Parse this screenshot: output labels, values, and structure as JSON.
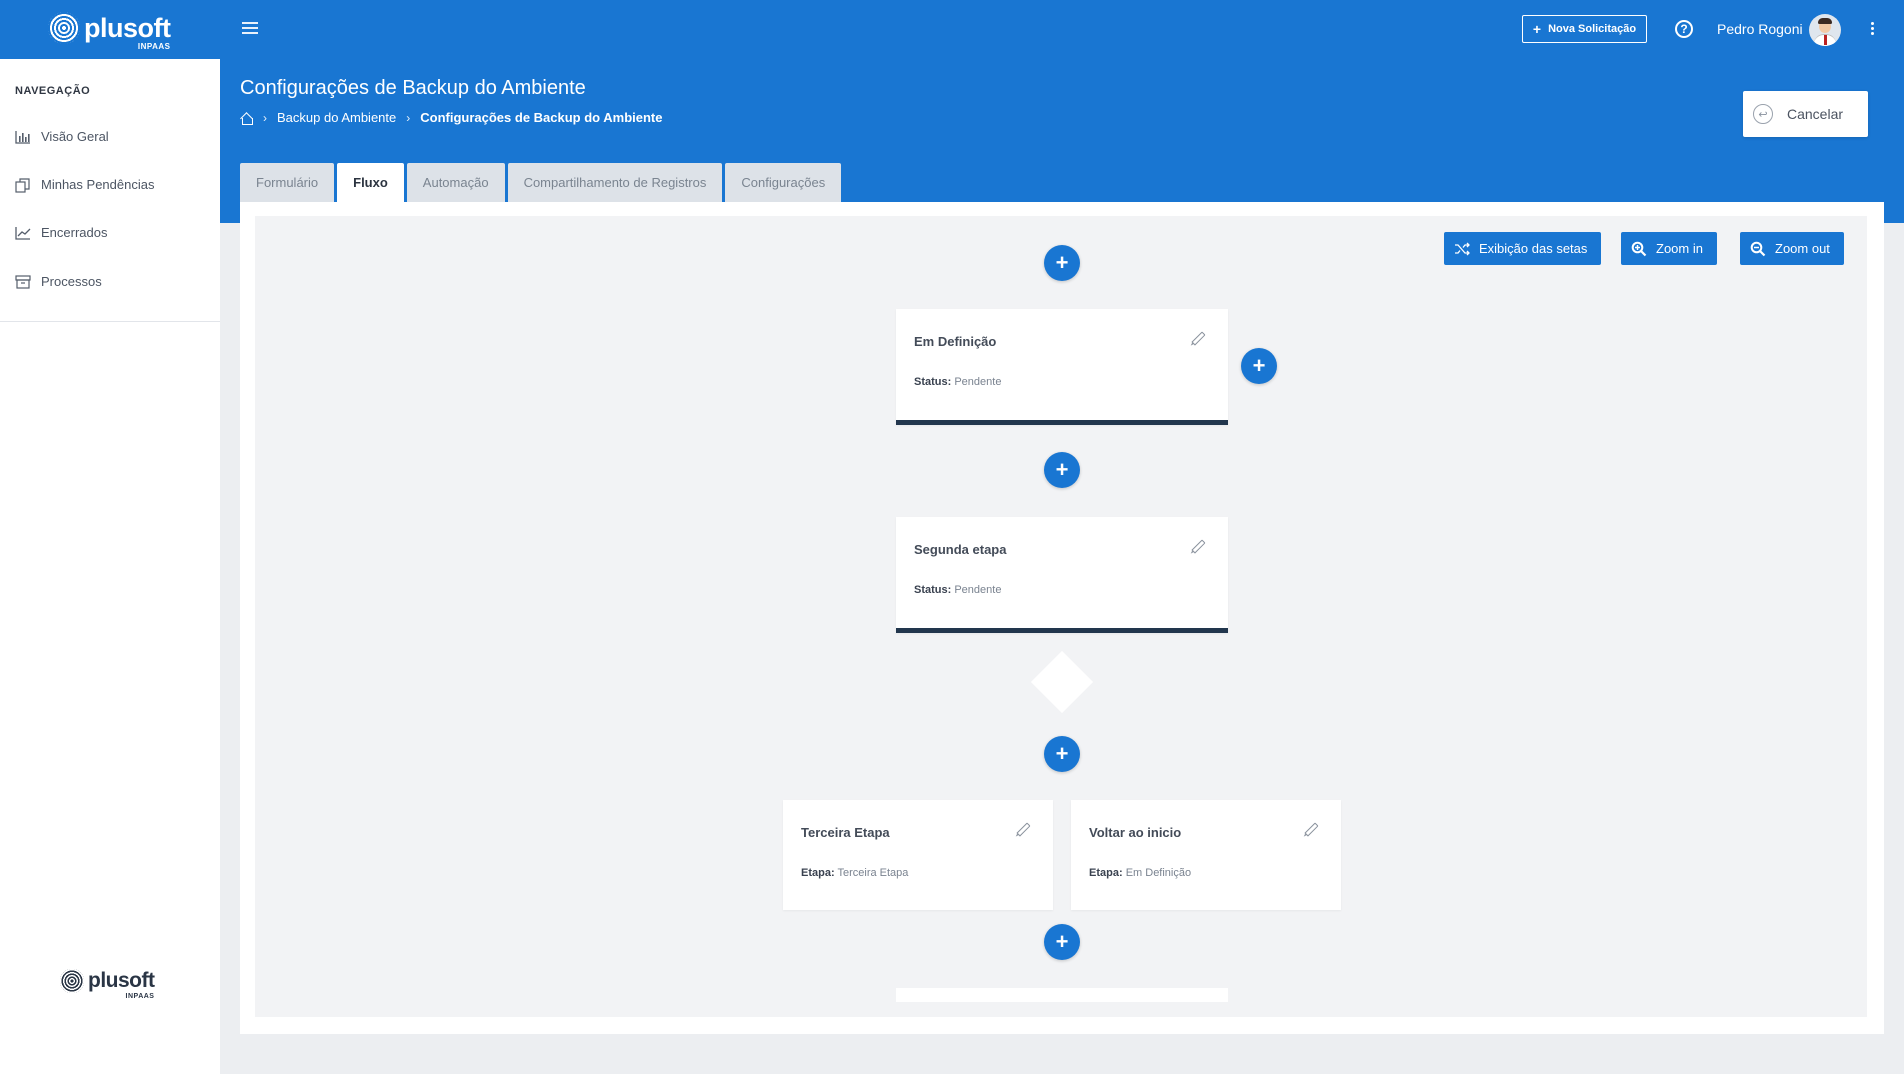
{
  "app": {
    "logo_text": "plusoft",
    "logo_sub": "INPAAS"
  },
  "topbar": {
    "new_request_label": "Nova Solicitação",
    "help_symbol": "?",
    "user_name": "Pedro Rogoni"
  },
  "sidebar": {
    "header": "NAVEGAÇÃO",
    "items": [
      {
        "label": "Visão Geral",
        "icon": "bar-chart-icon"
      },
      {
        "label": "Minhas Pendências",
        "icon": "copy-icon"
      },
      {
        "label": "Encerrados",
        "icon": "line-chart-icon"
      },
      {
        "label": "Processos",
        "icon": "archive-icon"
      }
    ]
  },
  "page": {
    "title": "Configurações de Backup do Ambiente",
    "breadcrumb": [
      "Backup do Ambiente",
      "Configurações de Backup do Ambiente"
    ],
    "cancel_label": "Cancelar"
  },
  "tabs": [
    {
      "label": "Formulário",
      "active": false
    },
    {
      "label": "Fluxo",
      "active": true
    },
    {
      "label": "Automação",
      "active": false
    },
    {
      "label": "Compartilhamento de Registros",
      "active": false
    },
    {
      "label": "Configurações",
      "active": false
    }
  ],
  "toolbar": {
    "arrows_label": "Exibição das setas",
    "zoom_in_label": "Zoom in",
    "zoom_out_label": "Zoom out"
  },
  "flow": {
    "add_symbol": "+",
    "nodes": [
      {
        "title": "Em Definição",
        "meta_key": "Status:",
        "meta_value": "Pendente"
      },
      {
        "title": "Segunda etapa",
        "meta_key": "Status:",
        "meta_value": "Pendente"
      },
      {
        "title": "Terceira Etapa",
        "meta_key": "Etapa:",
        "meta_value": "Terceira Etapa"
      },
      {
        "title": "Voltar ao inicio",
        "meta_key": "Etapa:",
        "meta_value": "Em Definição"
      }
    ]
  },
  "colors": {
    "primary": "#1976d2",
    "node_bar": "#22364d",
    "canvas_bg": "#f2f3f5"
  }
}
